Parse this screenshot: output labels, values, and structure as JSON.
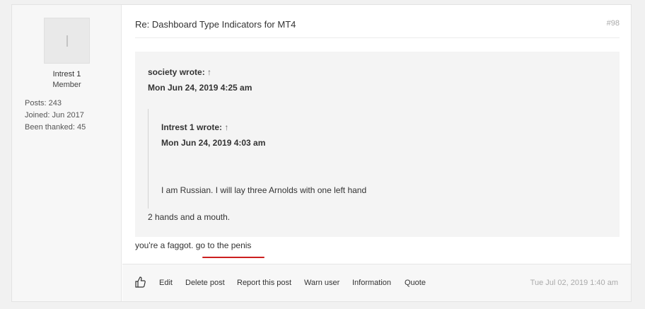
{
  "author": {
    "username": "Intrest 1",
    "rank": "Member",
    "stats": [
      {
        "label": "Posts:",
        "value": "243"
      },
      {
        "label": "Joined:",
        "value": "Jun 2017"
      },
      {
        "label": "Been thanked:",
        "value": "45"
      }
    ]
  },
  "post": {
    "title": "Re: Dashboard Type Indicators for MT4",
    "number": "#98",
    "quote": {
      "author_line": "society wrote:",
      "arrow": "↑",
      "date": "Mon Jun 24, 2019 4:25 am",
      "nested": {
        "author_line": "Intrest 1 wrote:",
        "arrow": "↑",
        "date": "Mon Jun 24, 2019 4:03 am",
        "text": "I am Russian. I will lay three Arnolds with one left hand"
      },
      "text": "2 hands and a mouth."
    },
    "reply_text": "you're a faggot.",
    "reply_link": "go to the penis",
    "timestamp": "Tue Jul 02, 2019 1:40 am"
  },
  "actions": {
    "like_icon": "thumbs-up-icon",
    "edit": "Edit",
    "delete": "Delete post",
    "report": "Report this post",
    "warn": "Warn user",
    "information": "Information",
    "quote": "Quote"
  },
  "colors": {
    "annotation_underline": "#cc1f1f"
  }
}
